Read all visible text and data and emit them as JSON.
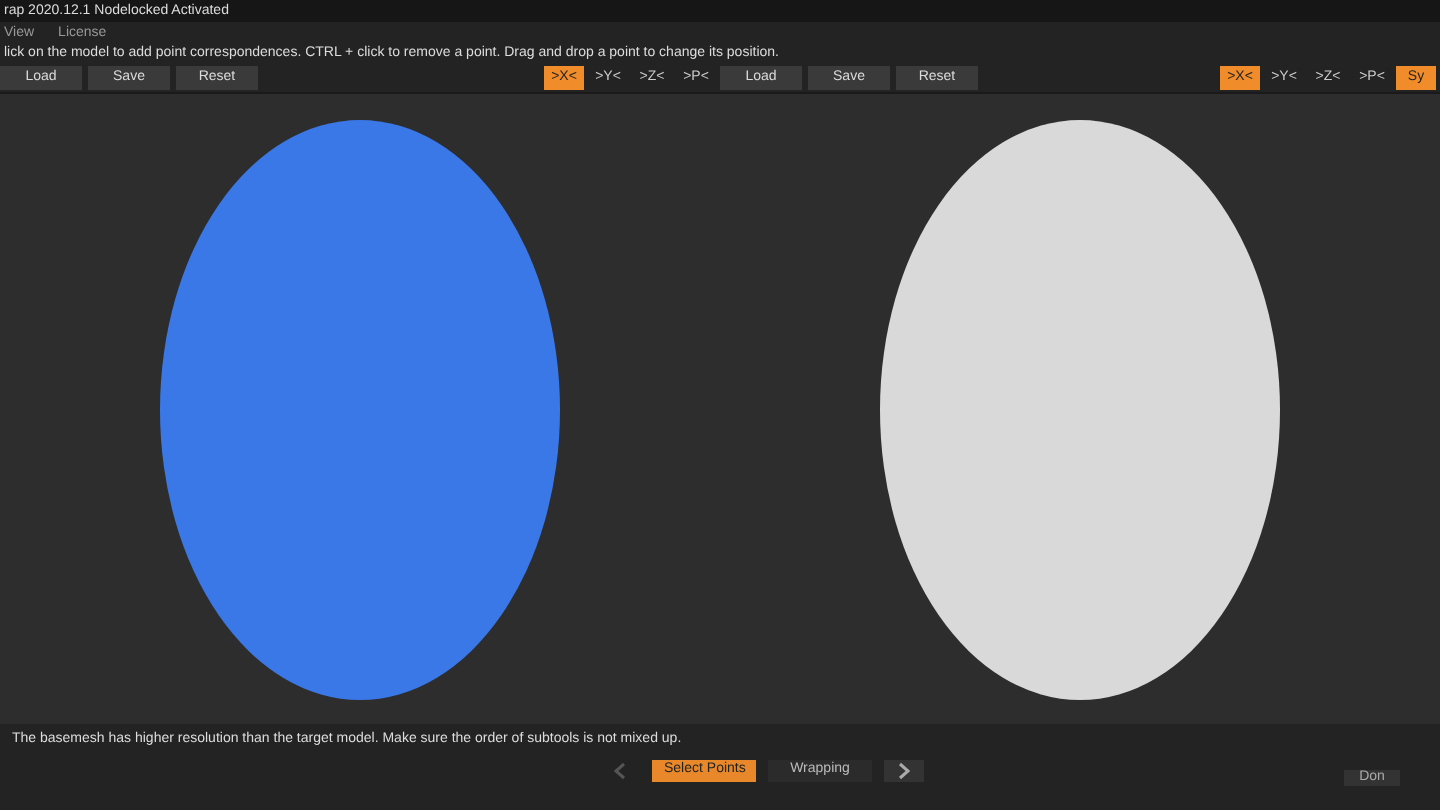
{
  "window": {
    "title": "rap 2020.12.1  Nodelocked Activated"
  },
  "menu": [
    "View",
    "License"
  ],
  "instruction": "lick on the model to add point correspondences. CTRL + click to remove a point. Drag and drop a point to change its position.",
  "toolbars": [
    {
      "buttons": [
        "Load",
        "Save",
        "Reset"
      ],
      "axes": [
        {
          "label": ">X<",
          "selected": true
        },
        {
          "label": ">Y<",
          "selected": false
        },
        {
          "label": ">Z<",
          "selected": false
        },
        {
          "label": ">P<",
          "selected": false
        }
      ]
    },
    {
      "buttons": [
        "Load",
        "Save",
        "Reset"
      ],
      "axes": [
        {
          "label": ">X<",
          "selected": true
        },
        {
          "label": ">Y<",
          "selected": false
        },
        {
          "label": ">Z<",
          "selected": false
        },
        {
          "label": ">P<",
          "selected": false
        },
        {
          "label": "Sy",
          "selected": true
        }
      ]
    }
  ],
  "viewports": [
    {
      "kind": "basemesh"
    },
    {
      "kind": "target"
    }
  ],
  "message": "The basemesh has higher resolution than the target model. Make sure the order of subtools is not mixed up.",
  "steps": [
    {
      "label": "Select Points",
      "selected": true
    },
    {
      "label": "Wrapping",
      "selected": false
    }
  ],
  "prev": {
    "disabled": true
  },
  "next": {
    "disabled": false
  },
  "done_button": "Don"
}
